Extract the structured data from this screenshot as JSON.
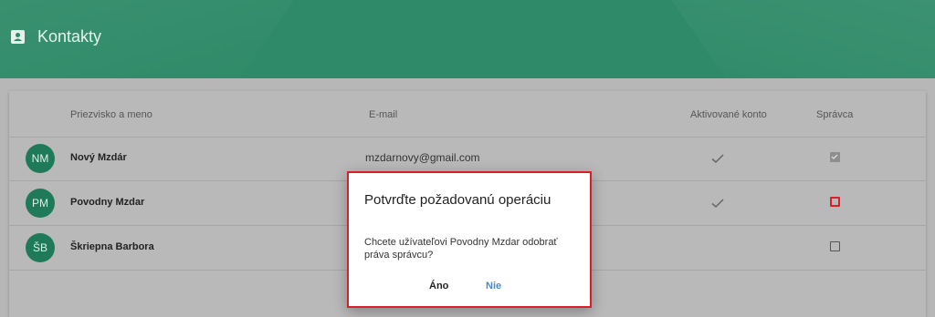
{
  "app": {
    "title": "Kontakty",
    "icon": "contact-card-icon"
  },
  "table": {
    "headers": {
      "name": "Priezvisko a meno",
      "email": "E-mail",
      "active": "Aktivované konto",
      "admin": "Správca"
    },
    "rows": [
      {
        "initials": "NM",
        "name": "Nový Mzdár",
        "email": "mzdarnovy@gmail.com",
        "active": true,
        "admin": true
      },
      {
        "initials": "PM",
        "name": "Povodny Mzdar",
        "email": "",
        "active": true,
        "admin": false
      },
      {
        "initials": "ŠB",
        "name": "Škriepna Barbora",
        "email": "",
        "active": false,
        "admin": false
      }
    ]
  },
  "dialog": {
    "title": "Potvrďte požadovanú operáciu",
    "message": "Chcete užívateľovi Povodny Mzdar odobrať práva správcu?",
    "yes_label": "Áno",
    "no_label": "Nie"
  },
  "colors": {
    "header": "#2e8a68",
    "avatar": "#1f7a59",
    "highlight": "#d9202a",
    "link": "#4a8ac9"
  }
}
